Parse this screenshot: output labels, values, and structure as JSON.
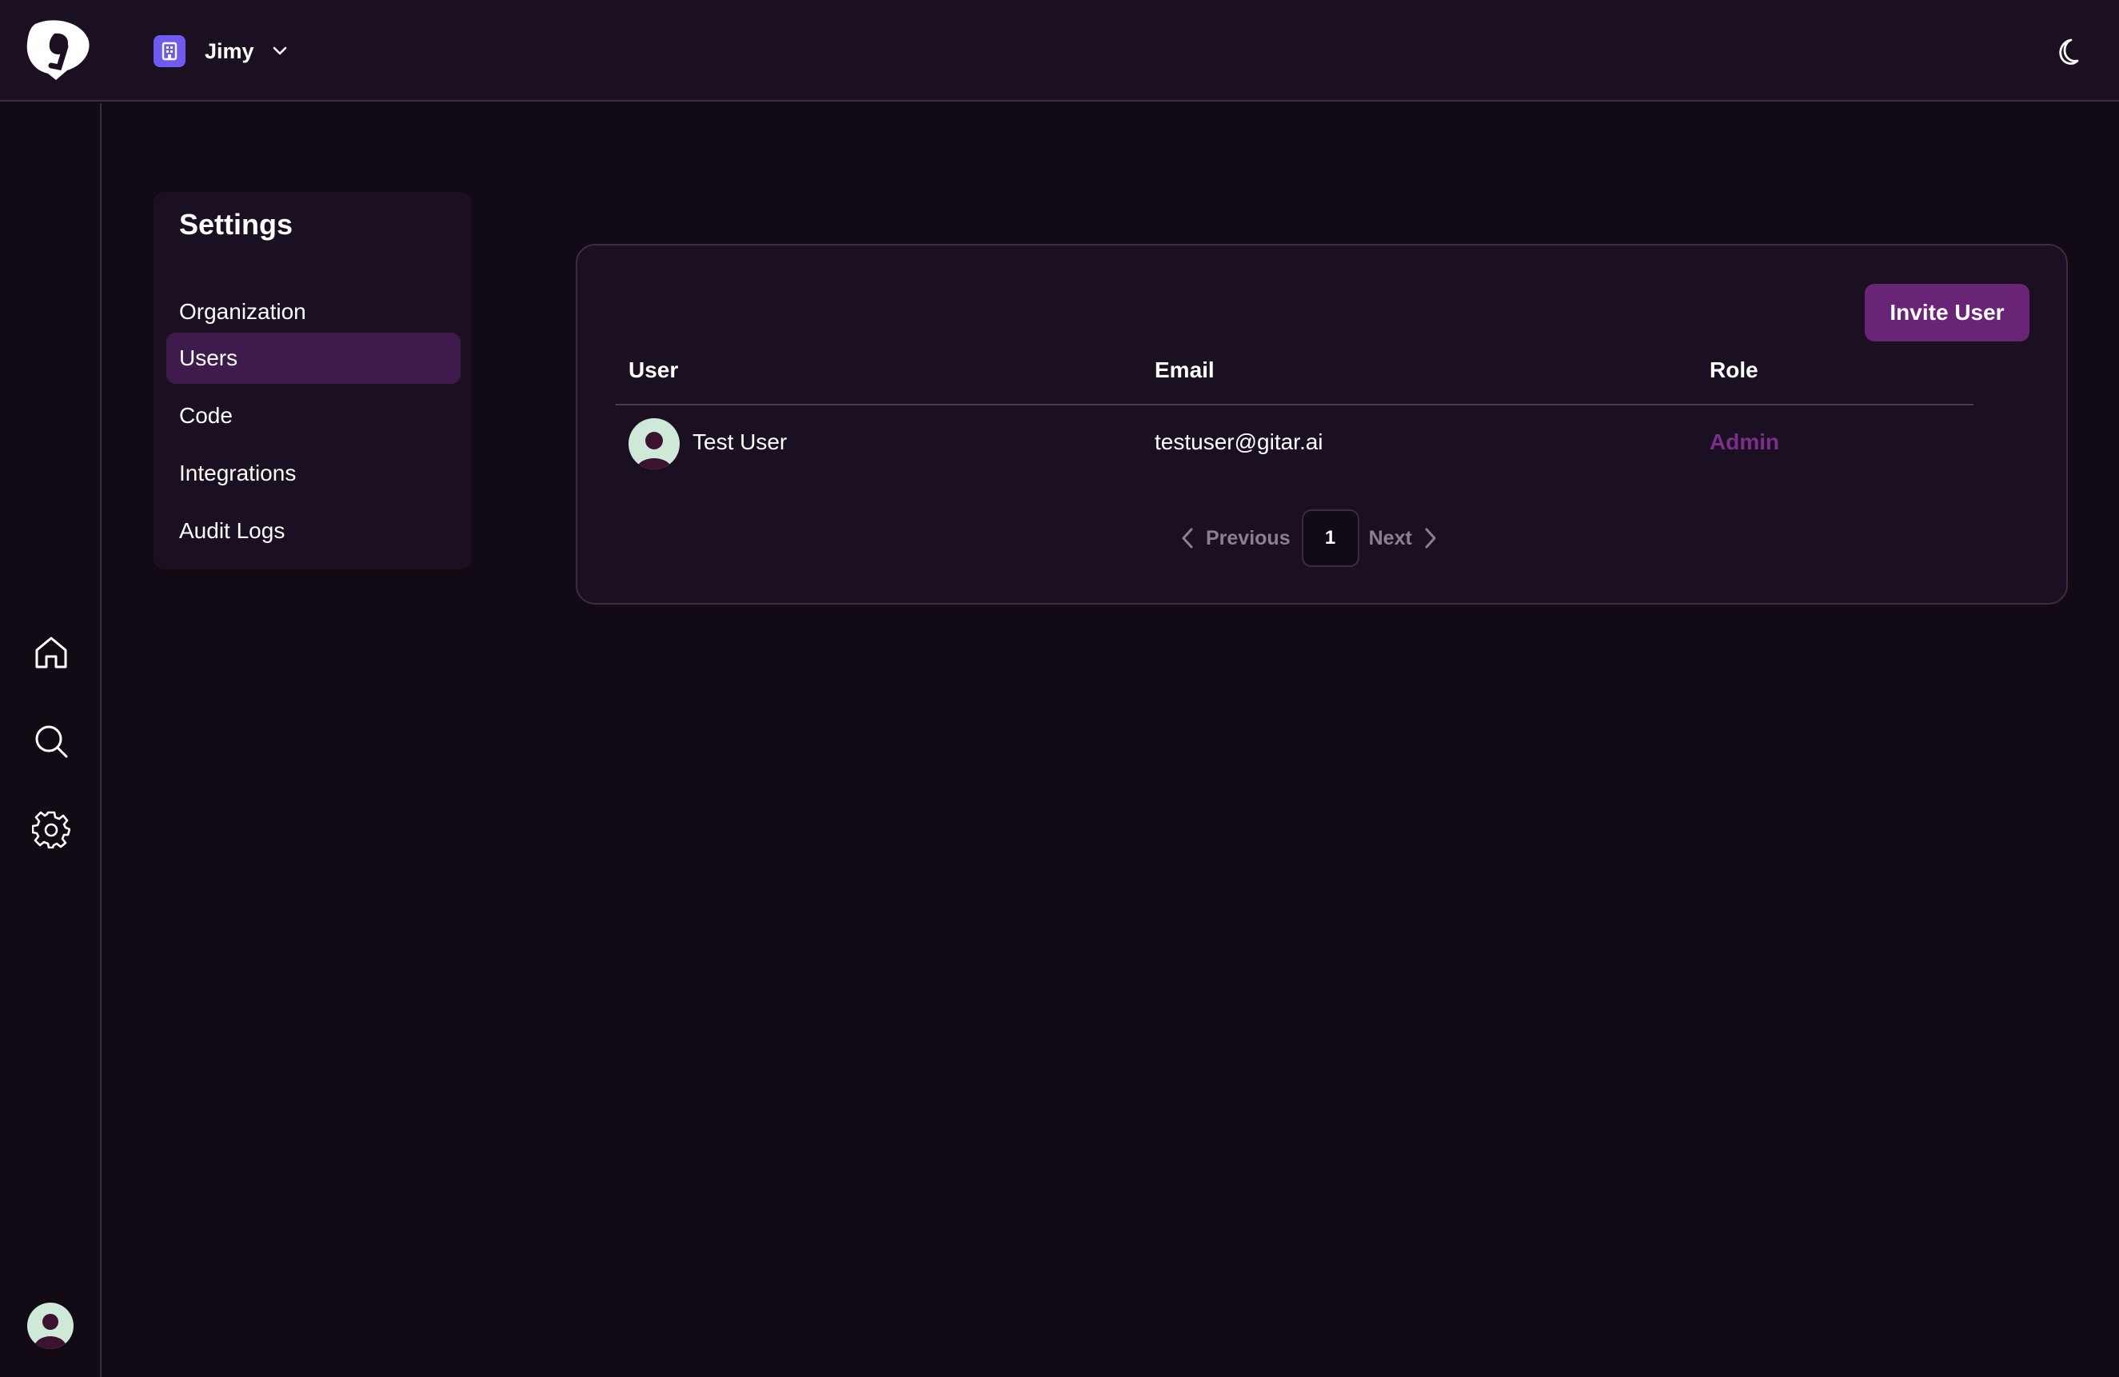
{
  "org": {
    "name": "Jimy"
  },
  "settings": {
    "title": "Settings",
    "nav": [
      {
        "label": "Organization",
        "active": false
      },
      {
        "label": "Users",
        "active": true
      },
      {
        "label": "Code",
        "active": false
      },
      {
        "label": "Integrations",
        "active": false
      },
      {
        "label": "Audit Logs",
        "active": false
      }
    ]
  },
  "users_table": {
    "invite_label": "Invite User",
    "columns": [
      "User",
      "Email",
      "Role"
    ],
    "rows": [
      {
        "name": "Test User",
        "email": "testuser@gitar.ai",
        "role": "Admin"
      }
    ]
  },
  "pagination": {
    "previous_label": "Previous",
    "current_page": "1",
    "next_label": "Next"
  },
  "icons": {
    "logo": "gitar-logo-icon",
    "org_badge": "building-icon",
    "org_dropdown": "chevron-down-icon",
    "theme": "moon-icon",
    "rail": [
      "home-icon",
      "search-icon",
      "gear-icon"
    ],
    "user": "avatar-icon"
  },
  "colors": {
    "background": "#120a14",
    "panel": "#1a1022",
    "accent": "#6a2477",
    "active_nav": "#3f1a4c",
    "role_text": "#7a2f8a",
    "org_badge": "#6f5af2"
  }
}
